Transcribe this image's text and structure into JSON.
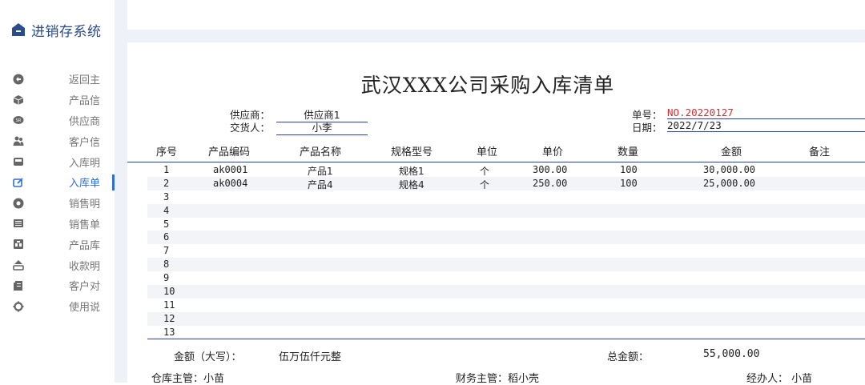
{
  "app": {
    "title": "进销存系统"
  },
  "sidebar": {
    "items": [
      {
        "label": "返回主",
        "icon": "back-icon"
      },
      {
        "label": "产品信",
        "icon": "box-icon"
      },
      {
        "label": "供应商",
        "icon": "supplier-icon"
      },
      {
        "label": "客户信",
        "icon": "users-icon"
      },
      {
        "label": "入库明",
        "icon": "inbox-icon"
      },
      {
        "label": "入库单",
        "icon": "edit-icon",
        "active": true
      },
      {
        "label": "销售明",
        "icon": "tag-icon"
      },
      {
        "label": "销售单",
        "icon": "list-icon"
      },
      {
        "label": "产品库",
        "icon": "warehouse-icon"
      },
      {
        "label": "收款明",
        "icon": "scale-icon"
      },
      {
        "label": "客户对",
        "icon": "document-icon"
      },
      {
        "label": "使用说",
        "icon": "gear-icon"
      }
    ]
  },
  "doc": {
    "title": "武汉XXX公司采购入库清单",
    "supplier_label": "供应商：",
    "supplier_value": "供应商1",
    "deliverer_label": "交货人：",
    "deliverer_value": "小李",
    "number_label": "单号：",
    "number_value": "NO.20220127",
    "date_label": "日期：",
    "date_value": "2022/7/23"
  },
  "table": {
    "headers": [
      "序号",
      "产品编码",
      "产品名称",
      "规格型号",
      "单位",
      "单价",
      "数量",
      "金额",
      "备注"
    ],
    "rows": [
      {
        "no": "1",
        "code": "ak0001",
        "name": "产品1",
        "spec": "规格1",
        "unit": "个",
        "price": "300.00",
        "qty": "100",
        "amount": "30,000.00"
      },
      {
        "no": "2",
        "code": "ak0004",
        "name": "产品4",
        "spec": "规格4",
        "unit": "个",
        "price": "250.00",
        "qty": "100",
        "amount": "25,000.00"
      },
      {
        "no": "3"
      },
      {
        "no": "4"
      },
      {
        "no": "5"
      },
      {
        "no": "6"
      },
      {
        "no": "7"
      },
      {
        "no": "8"
      },
      {
        "no": "9"
      },
      {
        "no": "10"
      },
      {
        "no": "11"
      },
      {
        "no": "12"
      },
      {
        "no": "13"
      }
    ]
  },
  "totals": {
    "amount_words_label": "金额（大写）：",
    "amount_words_value": "伍万伍仟元整",
    "total_label": "总金额：",
    "total_value": "55,000.00"
  },
  "footer": {
    "warehouse": "仓库主管：小苗",
    "finance": "财务主管：稻小壳",
    "handler": "经办人： 小苗"
  },
  "colors": {
    "accent": "#2e6fd6",
    "brand": "#2b4c8a",
    "rule": "#2a3fae",
    "number": "#d23030",
    "band": "#eef1f8"
  }
}
